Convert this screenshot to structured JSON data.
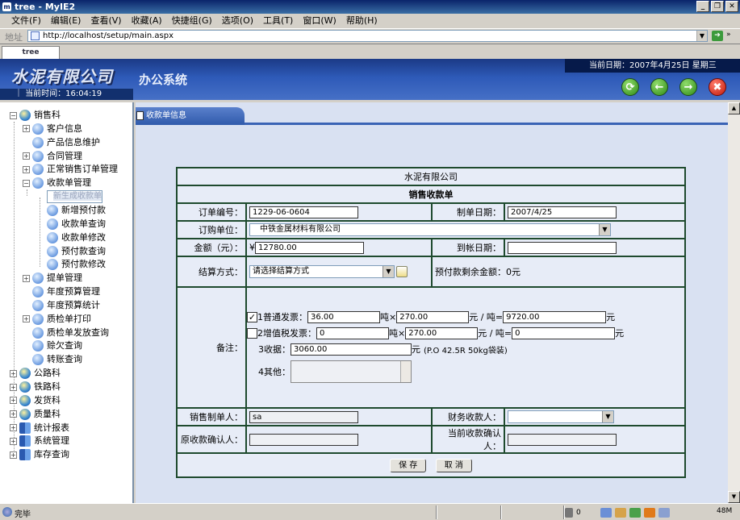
{
  "window": {
    "title": "tree - MyIE2"
  },
  "menu": [
    "文件(F)",
    "编辑(E)",
    "查看(V)",
    "收藏(A)",
    "快捷组(G)",
    "选项(O)",
    "工具(T)",
    "窗口(W)",
    "帮助(H)"
  ],
  "address": {
    "label": "地址",
    "url": "http://localhost/setup/main.aspx"
  },
  "tabs": [
    {
      "label": "tree"
    }
  ],
  "banner": {
    "company": "水泥有限公司",
    "system": "办公系统",
    "date_text": "当前日期：2007年4月25日  星期三"
  },
  "time_text": "当前时间：16:04:19",
  "tree": {
    "items": [
      {
        "label": "销售科",
        "level": 0,
        "expanded": true
      },
      {
        "label": "客户信息",
        "level": 1
      },
      {
        "label": "产品信息维护",
        "level": 1
      },
      {
        "label": "合同管理",
        "level": 1
      },
      {
        "label": "正常销售订单管理",
        "level": 1
      },
      {
        "label": "收款单管理",
        "level": 1,
        "expanded": true
      },
      {
        "label": "新生成收款单",
        "level": 2,
        "selected": true
      },
      {
        "label": "新增预付款",
        "level": 2
      },
      {
        "label": "收款单查询",
        "level": 2
      },
      {
        "label": "收款单修改",
        "level": 2
      },
      {
        "label": "预付款查询",
        "level": 2
      },
      {
        "label": "预付款修改",
        "level": 2
      },
      {
        "label": "提单管理",
        "level": 1
      },
      {
        "label": "年度预算管理",
        "level": 1
      },
      {
        "label": "年度预算统计",
        "level": 1
      },
      {
        "label": "质检单打印",
        "level": 1
      },
      {
        "label": "质检单发放查询",
        "level": 1
      },
      {
        "label": "赊欠查询",
        "level": 1
      },
      {
        "label": "转账查询",
        "level": 1
      },
      {
        "label": "公路科",
        "level": 0
      },
      {
        "label": "铁路科",
        "level": 0
      },
      {
        "label": "发货科",
        "level": 0
      },
      {
        "label": "质量科",
        "level": 0
      },
      {
        "label": "统计报表",
        "level": 0
      },
      {
        "label": "系统管理",
        "level": 0
      },
      {
        "label": "库存查询",
        "level": 0
      }
    ]
  },
  "content": {
    "tab_label": "收款单信息"
  },
  "form": {
    "company": "水泥有限公司",
    "title": "销售收款单",
    "order_no_label": "订单编号：",
    "order_no": "1229-06-0604",
    "create_date_label": "制单日期：",
    "create_date": "2007/4/25",
    "buyer_label": "订购单位：",
    "buyer": "中铁金属材料有限公司",
    "amount_label": "金额（元）：",
    "amount_prefix": "¥",
    "amount": "12780.00",
    "arrival_date_label": "到帐日期：",
    "arrival_date": "",
    "settle_label": "结算方式：",
    "settle_value": "请选择结算方式",
    "prepay_remain": "预付款剩余金额：0元",
    "remark_label": "备注：",
    "line1": {
      "checked": true,
      "label": "1普通发票：",
      "tons": "36.00",
      "t_unit": "吨×",
      "price": "270.00",
      "p_unit": "元 / 吨=",
      "total": "9720.00",
      "total_unit": "元"
    },
    "line2": {
      "checked": false,
      "label": "2增值税发票：",
      "tons": "0",
      "t_unit": "吨×",
      "price": "270.00",
      "p_unit": "元 / 吨=",
      "total": "0",
      "total_unit": "元"
    },
    "line3": {
      "label": "3收据：",
      "value": "3060.00",
      "unit": "元",
      "note": "(P.O 42.5R 50kg袋装)"
    },
    "line4": {
      "label": "4其他：",
      "value": ""
    },
    "sales_maker_label": "销售制单人：",
    "sales_maker": "sa",
    "finance_receiver_label": "财务收款人：",
    "finance_receiver": "",
    "orig_confirm_label": "原收款确认人：",
    "orig_confirm": "",
    "cur_confirm_label": "当前收款确认人：",
    "cur_confirm": "",
    "save_button": "保 存",
    "cancel_button": "取 消"
  },
  "status": {
    "text": "完毕",
    "zoom_num": "0",
    "memory": "48M"
  }
}
